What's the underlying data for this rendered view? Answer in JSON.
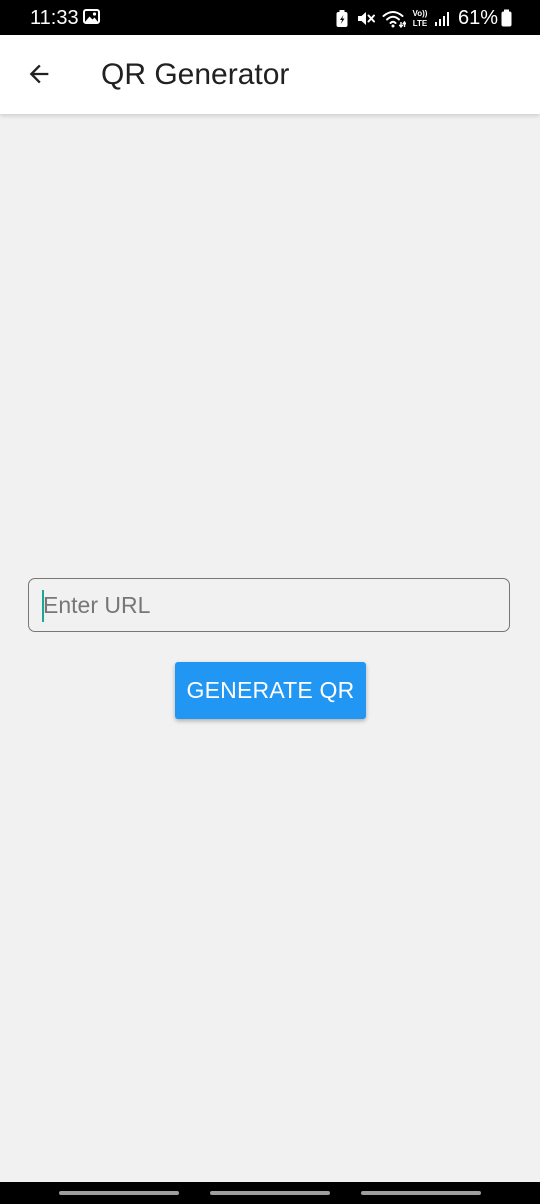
{
  "status_bar": {
    "time": "11:33",
    "battery": "61%",
    "icons": [
      "gallery-icon",
      "battery-saver-icon",
      "mute-icon",
      "wifi-icon",
      "volte-icon",
      "signal-icon",
      "battery-icon"
    ]
  },
  "app_bar": {
    "title": "QR Generator",
    "back_icon": "arrow-back-icon"
  },
  "form": {
    "url_value": "",
    "url_placeholder": "Enter URL",
    "generate_label": "GENERATE QR"
  },
  "colors": {
    "accent": "#2196f3",
    "background": "#f1f1f1",
    "cursor": "#1aa79a"
  }
}
